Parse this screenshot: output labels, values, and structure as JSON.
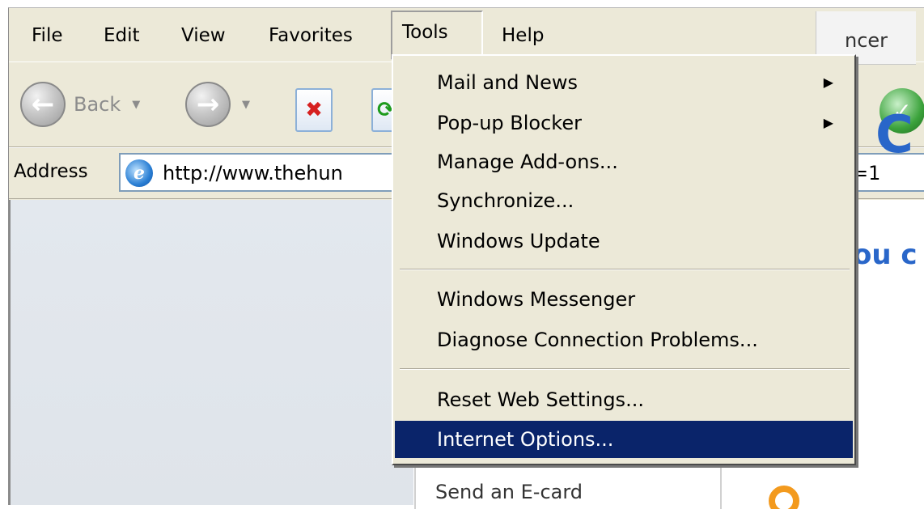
{
  "menubar": {
    "items": [
      "File",
      "Edit",
      "View",
      "Favorites",
      "Tools",
      "Help"
    ],
    "active": "Tools"
  },
  "toolbar": {
    "back_label": "Back"
  },
  "address": {
    "label": "Address",
    "url_visible": "http://www.thehun",
    "url_tail": "=1"
  },
  "webpage": {
    "tab_text": "ncer",
    "big_letter": "C",
    "fragment": "ou c",
    "side_link": "Send an E-card"
  },
  "tools_menu": {
    "items": [
      {
        "label": "Mail and News",
        "submenu": true
      },
      {
        "label": "Pop-up Blocker",
        "submenu": true
      },
      {
        "label": "Manage Add-ons...",
        "submenu": false
      },
      {
        "label": "Synchronize...",
        "submenu": false
      },
      {
        "label": "Windows Update",
        "submenu": false
      },
      {
        "label": "Windows Messenger",
        "submenu": false
      },
      {
        "label": "Diagnose Connection Problems...",
        "submenu": false
      },
      {
        "label": "Reset Web Settings...",
        "submenu": false
      },
      {
        "label": "Internet Options...",
        "submenu": false
      }
    ],
    "selected": "Internet Options..."
  },
  "icons": {
    "back": "back-arrow-icon",
    "forward": "forward-arrow-icon",
    "stop": "stop-icon",
    "refresh": "refresh-icon",
    "history": "history-icon",
    "ie": "internet-explorer-icon",
    "submenu": "submenu-arrow-icon"
  },
  "colors": {
    "selection": "#0a246a",
    "chrome": "#ece9d8",
    "link_blue": "#2966c9"
  }
}
